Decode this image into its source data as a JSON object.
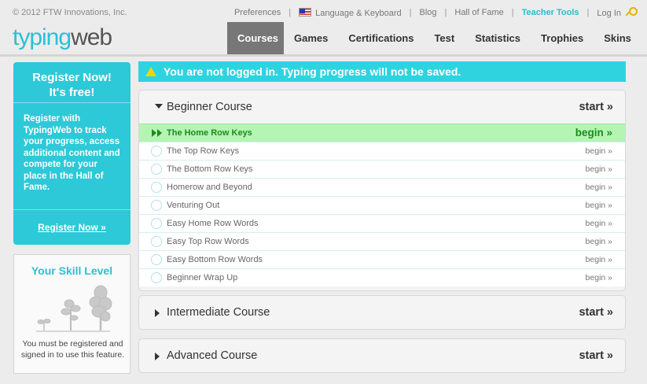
{
  "topbar": {
    "copyright": "© 2012 FTW Innovations, Inc.",
    "links": {
      "preferences": "Preferences",
      "language": "Language & Keyboard",
      "blog": "Blog",
      "hall_of_fame": "Hall of Fame",
      "teacher_tools": "Teacher Tools",
      "login": "Log In"
    },
    "separator": "|"
  },
  "logo": {
    "part1": "typing",
    "part2": "web"
  },
  "nav": {
    "items": [
      "Courses",
      "Games",
      "Certifications",
      "Test",
      "Statistics",
      "Trophies",
      "Skins"
    ],
    "active": "Courses"
  },
  "register": {
    "heading_line1": "Register Now!",
    "heading_line2": "It's free!",
    "body": "Register with TypingWeb to track your progress, access additional content and compete for your place in the Hall of Fame.",
    "button": "Register Now »"
  },
  "skill": {
    "title": "Your Skill Level",
    "message": "You must be registered and signed in to use this feature."
  },
  "alert": {
    "text": "You are not logged in. Typing progress will not be saved."
  },
  "courses": [
    {
      "title": "Beginner Course",
      "start": "start »",
      "lessons": [
        {
          "name": "The Home Row Keys",
          "action": "begin »"
        },
        {
          "name": "The Top Row Keys",
          "action": "begin »"
        },
        {
          "name": "The Bottom Row Keys",
          "action": "begin »"
        },
        {
          "name": "Homerow and Beyond",
          "action": "begin »"
        },
        {
          "name": "Venturing Out",
          "action": "begin »"
        },
        {
          "name": "Easy Home Row Words",
          "action": "begin »"
        },
        {
          "name": "Easy Top Row Words",
          "action": "begin »"
        },
        {
          "name": "Easy Bottom Row Words",
          "action": "begin »"
        },
        {
          "name": "Beginner Wrap Up",
          "action": "begin »"
        }
      ]
    },
    {
      "title": "Intermediate Course",
      "start": "start »"
    },
    {
      "title": "Advanced Course",
      "start": "start »"
    }
  ],
  "colors": {
    "accent": "#2cc0d3",
    "current_lesson": "#b4f5b4",
    "alert_bg": "#2fd3e0"
  }
}
